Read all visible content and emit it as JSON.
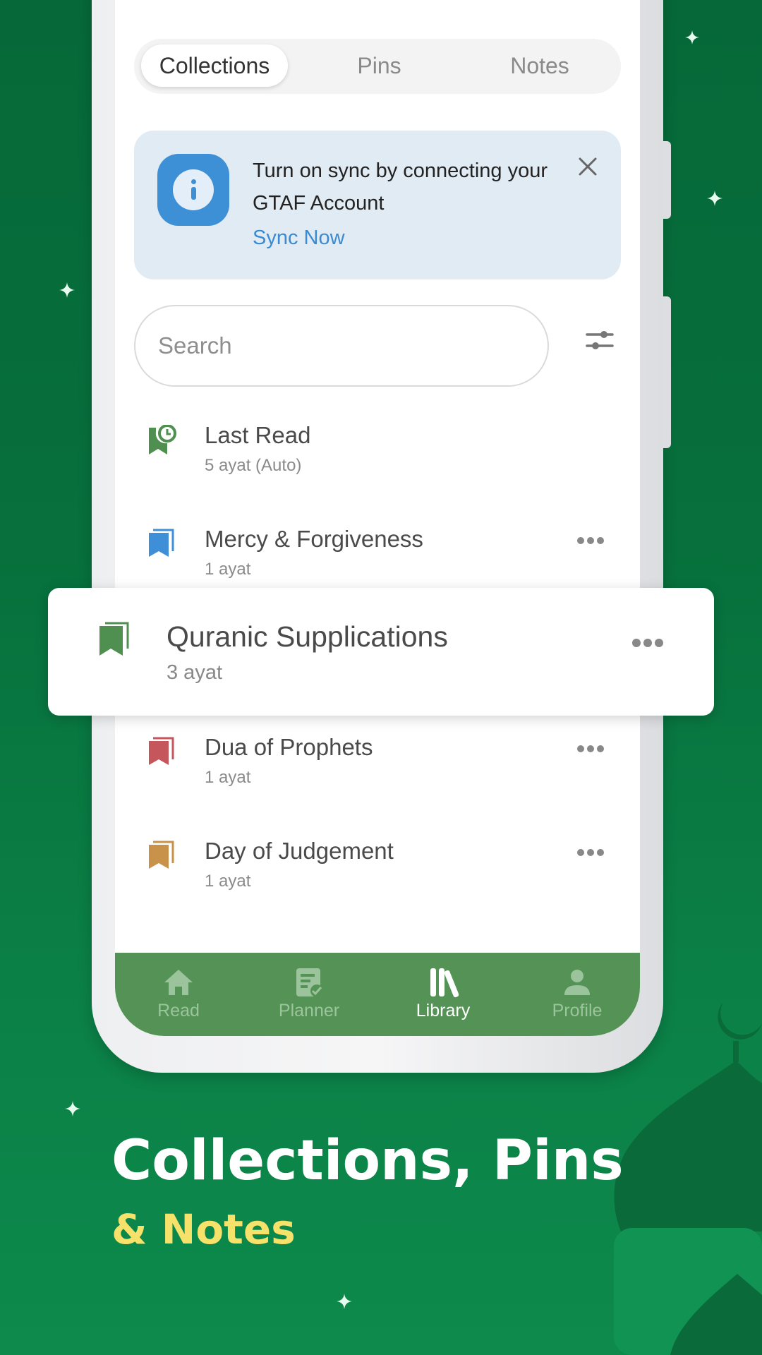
{
  "tabs": [
    {
      "label": "Collections",
      "active": true
    },
    {
      "label": "Pins",
      "active": false
    },
    {
      "label": "Notes",
      "active": false
    }
  ],
  "sync_banner": {
    "icon": "info-icon",
    "message": "Turn on sync by connecting your GTAF Account",
    "action_label": "Sync Now",
    "close_icon": "close-icon"
  },
  "search": {
    "placeholder": "Search",
    "value": "",
    "filter_icon": "sliders-icon"
  },
  "collections": [
    {
      "title": "Last Read",
      "subtitle": "5 ayat (Auto)",
      "icon": "bookmark-clock-icon",
      "color": "#4f8f4f",
      "has_menu": false
    },
    {
      "title": "Mercy & Forgiveness",
      "subtitle": "1 ayat",
      "icon": "bookmark-icon",
      "color": "#3e8fd8",
      "has_menu": true
    },
    {
      "title": "Quranic Supplications",
      "subtitle": "3 ayat",
      "icon": "bookmark-icon",
      "color": "#4f8f4f",
      "has_menu": true,
      "highlighted": true
    },
    {
      "title": "Dua of Prophets",
      "subtitle": "1 ayat",
      "icon": "bookmark-icon",
      "color": "#c5575c",
      "has_menu": true
    },
    {
      "title": "Day of Judgement",
      "subtitle": "1 ayat",
      "icon": "bookmark-icon",
      "color": "#c8924a",
      "has_menu": true
    }
  ],
  "bottom_nav": [
    {
      "label": "Read",
      "icon": "home-icon",
      "active": false
    },
    {
      "label": "Planner",
      "icon": "planner-icon",
      "active": false
    },
    {
      "label": "Library",
      "icon": "library-icon",
      "active": true
    },
    {
      "label": "Profile",
      "icon": "profile-icon",
      "active": false
    }
  ],
  "promo": {
    "headline": "Collections, Pins",
    "subline": "& Notes"
  },
  "colors": {
    "background": "#07703c",
    "nav_bar": "#549355",
    "accent_link": "#3a8bd1",
    "subline": "#f6e26b"
  }
}
